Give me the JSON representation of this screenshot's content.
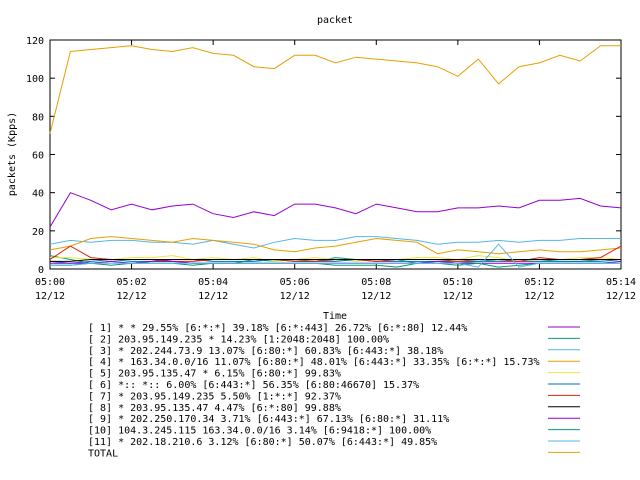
{
  "chart_data": {
    "type": "line",
    "title": "packet",
    "xlabel": "Time",
    "ylabel": "packets (Kpps)",
    "ylim": [
      0,
      120
    ],
    "y_ticks": [
      "0",
      "20",
      "40",
      "60",
      "80",
      "100",
      "120"
    ],
    "xlim": [
      0,
      14
    ],
    "x_ticks": [
      {
        "time": "05:00",
        "date": "12/12"
      },
      {
        "time": "05:02",
        "date": "12/12"
      },
      {
        "time": "05:04",
        "date": "12/12"
      },
      {
        "time": "05:06",
        "date": "12/12"
      },
      {
        "time": "05:08",
        "date": "12/12"
      },
      {
        "time": "05:10",
        "date": "12/12"
      },
      {
        "time": "05:12",
        "date": "12/12"
      },
      {
        "time": "05:14",
        "date": "12/12"
      }
    ],
    "x_step_minutes": 0.5,
    "grid": false,
    "legend_position": "bottom",
    "series": [
      {
        "name": "[ 1] * * 29.55%  [6:*:*] 39.18% [6:*:443] 26.72% [6:*:80] 12.44%",
        "color": "#9400d3",
        "values": [
          22,
          40,
          36,
          31,
          34,
          31,
          33,
          34,
          29,
          27,
          30,
          28,
          34,
          34,
          32,
          29,
          34,
          32,
          30,
          30,
          32,
          32,
          33,
          32,
          36,
          36,
          37,
          33,
          32
        ]
      },
      {
        "name": "[ 2] 203.95.149.235 * 14.23%  [1:2048:2048] 100.00%",
        "color": "#009e73",
        "values": [
          7,
          5,
          3,
          4,
          3,
          4,
          4,
          3,
          3,
          3,
          5,
          4,
          5,
          4,
          6,
          5,
          4,
          5,
          3,
          4,
          3,
          4,
          5,
          4,
          5,
          4,
          4,
          5,
          5
        ]
      },
      {
        "name": "[ 3] * 202.244.73.9 13.07%  [6:80:*] 60.83% [6:443:*] 38.18%",
        "color": "#56b4e9",
        "values": [
          13,
          15,
          14,
          15,
          15,
          14,
          14,
          13,
          15,
          13,
          11,
          14,
          16,
          15,
          15,
          17,
          17,
          16,
          15,
          13,
          14,
          14,
          15,
          14,
          15,
          15,
          16,
          16,
          16
        ]
      },
      {
        "name": "[ 4] * 163.34.0.0/16 11.07%  [6:80:*] 48.01% [6:443:*] 33.35% [6:*:*] 15.73%",
        "color": "#e69f00",
        "values": [
          10,
          12,
          16,
          17,
          16,
          15,
          14,
          16,
          15,
          14,
          13,
          10,
          9,
          11,
          12,
          14,
          16,
          15,
          14,
          8,
          10,
          9,
          8,
          9,
          10,
          9,
          9,
          10,
          11
        ]
      },
      {
        "name": "[ 5] 203.95.135.47 * 6.15%  [6:80:*] 99.83%",
        "color": "#f0e442",
        "values": [
          6,
          6,
          5,
          5,
          6,
          6,
          7,
          5,
          6,
          5,
          6,
          4,
          5,
          6,
          5,
          4,
          5,
          5,
          6,
          6,
          5,
          7,
          6,
          4,
          5,
          5,
          6,
          6,
          5
        ]
      },
      {
        "name": "[ 6] *:: *:: 6.00%  [6:443:*] 56.35% [6:80:46670] 15.37%",
        "color": "#0072b2",
        "values": [
          4,
          3,
          4,
          5,
          4,
          4,
          5,
          5,
          4,
          4,
          4,
          5,
          4,
          4,
          4,
          5,
          4,
          4,
          4,
          4,
          4,
          4,
          4,
          4,
          4,
          4,
          4,
          4,
          5
        ]
      },
      {
        "name": "[ 7] * 203.95.149.235 5.50%  [1:*:*] 92.37%",
        "color": "#e51e10",
        "values": [
          5,
          12,
          6,
          5,
          5,
          5,
          4,
          4,
          5,
          5,
          5,
          5,
          4,
          4,
          5,
          5,
          4,
          5,
          5,
          5,
          4,
          5,
          5,
          4,
          6,
          5,
          5,
          6,
          12
        ]
      },
      {
        "name": "[ 8] * 203.95.135.47 4.47%  [6:*:80] 99.88%",
        "color": "#000000",
        "values": [
          4,
          4,
          5,
          5,
          5,
          5,
          5,
          5,
          5,
          5,
          5,
          5,
          5,
          5,
          5,
          5,
          5,
          5,
          5,
          5,
          5,
          5,
          5,
          5,
          5,
          5,
          5,
          5,
          5
        ]
      },
      {
        "name": "[ 9] * 202.250.170.34 3.71%  [6:443:*] 67.13% [6:80:*] 31.11%",
        "color": "#9400d3",
        "values": [
          3,
          3,
          3,
          4,
          3,
          4,
          4,
          3,
          3,
          3,
          3,
          3,
          3,
          3,
          3,
          3,
          3,
          3,
          3,
          4,
          3,
          3,
          3,
          3,
          3,
          3,
          3,
          3,
          4
        ]
      },
      {
        "name": "[10] 104.3.245.115 163.34.0.0/16 3.14%  [6:9418:*] 100.00%",
        "color": "#009e73",
        "values": [
          2,
          2,
          3,
          2,
          3,
          3,
          3,
          2,
          3,
          3,
          3,
          3,
          3,
          3,
          2,
          2,
          2,
          1,
          3,
          3,
          2,
          3,
          1,
          2,
          3,
          3,
          3,
          3,
          3
        ]
      },
      {
        "name": "[11] * 202.18.210.6 3.12%  [6:80:*] 50.07% [6:443:*] 49.85%",
        "color": "#56b4e9",
        "values": [
          2,
          2,
          3,
          3,
          3,
          3,
          3,
          3,
          3,
          3,
          3,
          3,
          3,
          3,
          3,
          3,
          3,
          3,
          3,
          3,
          3,
          1,
          13,
          1,
          3,
          3,
          3,
          3,
          3
        ]
      },
      {
        "name": "TOTAL",
        "color": "#e69f00",
        "values": [
          71,
          114,
          115,
          116,
          117,
          115,
          114,
          116,
          113,
          112,
          106,
          105,
          112,
          112,
          108,
          111,
          110,
          109,
          108,
          106,
          101,
          110,
          97,
          106,
          108,
          112,
          109,
          117,
          117
        ]
      }
    ]
  }
}
